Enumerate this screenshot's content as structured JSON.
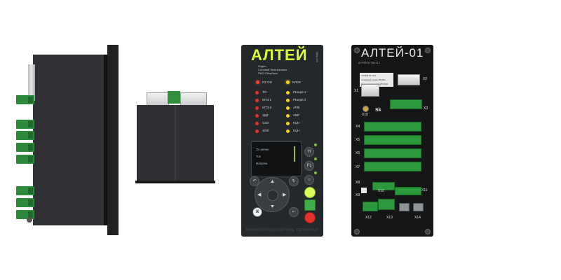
{
  "front": {
    "logo": "АЛТЕЙ",
    "info_lines": [
      "Отдел",
      "Силовой Электроники",
      "ПАО Сбербанк"
    ],
    "vertical_text": "altey.com",
    "led_header": [
      "РЗ ОФ",
      "БЛОК"
    ],
    "left_leds": [
      "ТО",
      "МТЗ-1",
      "МТЗ-2",
      "ЗДЗ",
      "ОЗЗ",
      "ЗОФ"
    ],
    "right_leds": [
      "Резерв 1",
      "Резерв 2",
      "АПВ",
      "АВР",
      "КЦН",
      "КЦН"
    ],
    "screen_lines": [
      "Ос.меню",
      "Ток",
      "Напряж."
    ],
    "side_buttons": [
      "Н",
      "F1",
      "☼"
    ],
    "brand_bottom": "МИКРОПРОЦЕССОРНОЕ ТЕРМИНАЛ"
  },
  "rear": {
    "logo": "АЛТЕЙ-01",
    "info_top": "АЛТЕЙ-01 Тип 31.2",
    "plate_lines": [
      "АЛТЕЙ-01 v3.0",
      "Серийный номер 000001",
      "Дата производства 05.2022"
    ],
    "labels": [
      "X1",
      "X2",
      "X3",
      "X4",
      "X5",
      "X6",
      "X7",
      "X8",
      "X9",
      "X10",
      "X11",
      "X12",
      "X13",
      "X14",
      "X15"
    ],
    "sk_mark": "Sk"
  },
  "colors": {
    "body": "#2e3033",
    "accent_green": "#2c9a3c",
    "logo_green": "#d9ff36",
    "led_red": "#e2332b",
    "led_yellow": "#f3d51d"
  }
}
